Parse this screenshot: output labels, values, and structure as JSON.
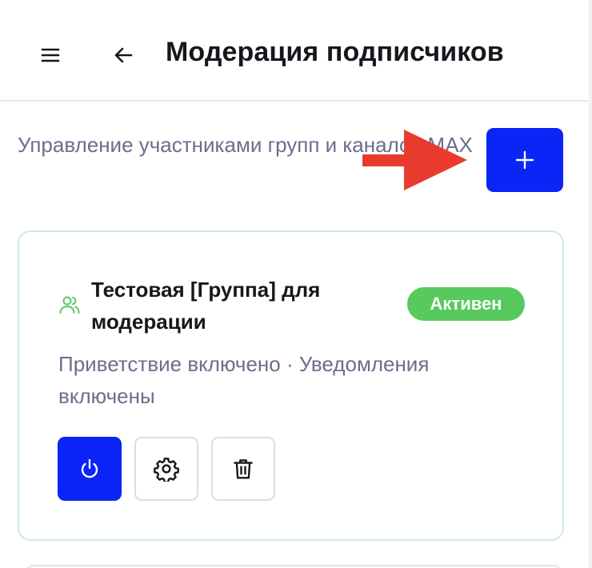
{
  "header": {
    "title": "Модерация подписчиков",
    "menu_icon": "hamburger-menu-icon",
    "back_icon": "arrow-left-icon"
  },
  "intro": {
    "description": "Управление участниками групп и каналов MAX",
    "add_icon": "plus-icon"
  },
  "groups": [
    {
      "icon": "users-icon",
      "name": "Тестовая [Группа] для модерации",
      "status": "Активен",
      "meta": "Приветствие включено · Уведомления включены",
      "actions": [
        {
          "icon": "power-icon",
          "style": "primary"
        },
        {
          "icon": "gear-icon",
          "style": "outline"
        },
        {
          "icon": "trash-icon",
          "style": "outline"
        }
      ]
    }
  ],
  "colors": {
    "primary": "#0a25f5",
    "active_badge": "#57c95d",
    "card_border": "#cfeadb",
    "annotation_arrow": "#e83b2e",
    "muted_text": "#6b6e8c"
  }
}
